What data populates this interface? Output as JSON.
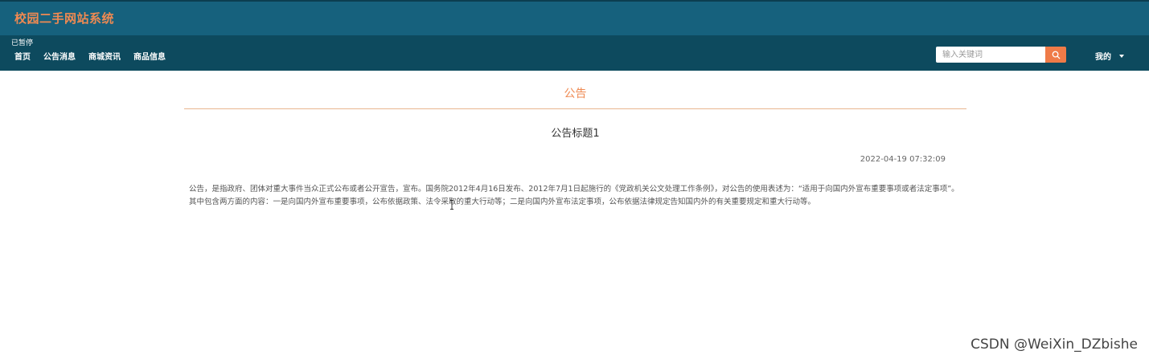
{
  "header": {
    "site_title": "校园二手网站系统",
    "title_color": "#ef8a52",
    "bar_color": "#16617d"
  },
  "navbar": {
    "paused_label": "已暂停",
    "items": [
      {
        "label": "首页"
      },
      {
        "label": "公告消息"
      },
      {
        "label": "商城资讯"
      },
      {
        "label": "商品信息"
      }
    ],
    "search": {
      "placeholder": "输入关键词",
      "value": "",
      "button_icon": "search-icon",
      "button_color": "#ef7b48"
    },
    "user_menu": {
      "label": "我的",
      "icon": "caret-down-icon"
    },
    "bar_color": "#0d4a5e"
  },
  "main": {
    "section_title": "公告",
    "notice": {
      "title": "公告标题1",
      "time": "2022-04-19 07:32:09",
      "body": "公告，是指政府、团体对重大事件当众正式公布或者公开宣告，宣布。国务院2012年4月16日发布、2012年7月1日起施行的《党政机关公文处理工作条例》，对公告的使用表述为：“适用于向国内外宣布重要事项或者法定事项”。其中包含两方面的内容：一是向国内外宣布重要事项，公布依据政策、法令采取的重大行动等；二是向国内外宣布法定事项，公布依据法律规定告知国内外的有关重要规定和重大行动等。"
    },
    "accent_color": "#ef8a52"
  },
  "watermark": "CSDN @WeiXin_DZbishe"
}
